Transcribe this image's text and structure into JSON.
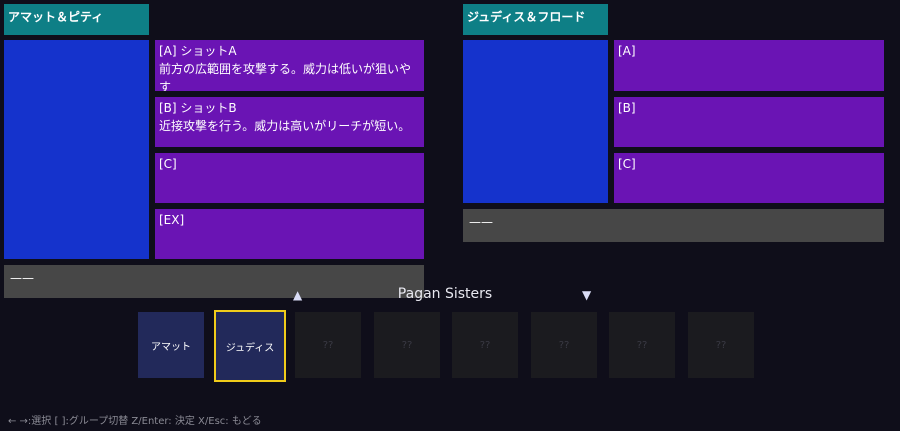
{
  "left_panel": {
    "title": "アマット＆ピティ",
    "skills": [
      {
        "name": "[A] ショットA",
        "desc": "前方の広範囲を攻撃する。威力は低いが狙いやす"
      },
      {
        "name": "[B] ショットB",
        "desc": "近接攻撃を行う。威力は高いがリーチが短い。"
      },
      {
        "name": "[C]",
        "desc": ""
      },
      {
        "name": "[EX]",
        "desc": ""
      }
    ],
    "bottom_bar": "——"
  },
  "right_panel": {
    "title": "ジュディス＆フロード",
    "skills": [
      {
        "name": "[A]",
        "desc": ""
      },
      {
        "name": "[B]",
        "desc": ""
      },
      {
        "name": "[C]",
        "desc": ""
      }
    ],
    "bottom_bar": "——"
  },
  "group": {
    "name": "Pagan Sisters",
    "up_arrow": "▲",
    "down_arrow": "▼"
  },
  "slots": [
    {
      "label": "アマット",
      "state": "filled"
    },
    {
      "label": "ジュディス",
      "state": "selected"
    },
    {
      "label": "??",
      "state": "locked"
    },
    {
      "label": "??",
      "state": "locked"
    },
    {
      "label": "??",
      "state": "locked"
    },
    {
      "label": "??",
      "state": "locked"
    },
    {
      "label": "??",
      "state": "locked"
    },
    {
      "label": "??",
      "state": "locked"
    }
  ],
  "help_text": "← →:選択 [ ]:グループ切替 Z/Enter: 決定 X/Esc: もどる",
  "colors": {
    "title_tab": "#0e7f86",
    "portrait": "#1533cc",
    "skill_box": "#6a14b4",
    "bar": "#474747",
    "selected_border": "#f0cc1a",
    "slot_filled": "#22295a",
    "slot_locked": "#1b1b1f",
    "background": "#0f0e1a"
  }
}
